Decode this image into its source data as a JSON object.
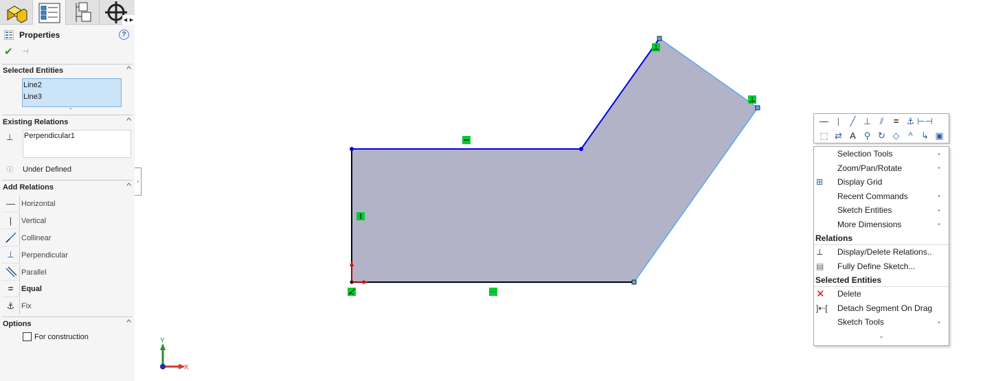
{
  "property_manager": {
    "tabs": [
      {
        "name": "feature-manager",
        "icon": "part-icon"
      },
      {
        "name": "property-manager",
        "icon": "property-list-icon",
        "active": true
      },
      {
        "name": "configuration-manager",
        "icon": "configuration-tree-icon"
      },
      {
        "name": "dim-xpert-manager",
        "icon": "crosshair-icon"
      }
    ],
    "title": "Properties",
    "help_icon": "?",
    "selected_entities": {
      "title": "Selected Entities",
      "items": [
        "Line2",
        "Line3"
      ]
    },
    "existing_relations": {
      "title": "Existing Relations",
      "items": [
        "Perpendicular1"
      ],
      "status": "Under Defined"
    },
    "add_relations": {
      "title": "Add Relations",
      "items": [
        {
          "label": "Horizontal",
          "icon": "horizontal-icon",
          "glyph": "—",
          "underline": "H",
          "bold": false
        },
        {
          "label": "Vertical",
          "icon": "vertical-icon",
          "glyph": "|",
          "bold": false
        },
        {
          "label": "Collinear",
          "icon": "collinear-icon",
          "glyph": "╱",
          "bold": false
        },
        {
          "label": "Perpendicular",
          "icon": "perpendicular-icon",
          "glyph": "⊥",
          "bold": false
        },
        {
          "label": "Parallel",
          "icon": "parallel-icon",
          "glyph": "⫽",
          "bold": false
        },
        {
          "label": "Equal",
          "icon": "equal-icon",
          "glyph": "=",
          "bold": true
        },
        {
          "label": "Fix",
          "icon": "fix-anchor-icon",
          "glyph": "⚓",
          "bold": false
        }
      ]
    },
    "options": {
      "title": "Options",
      "for_construction_label": "For construction",
      "for_construction_checked": false
    }
  },
  "sketch": {
    "relation_badges": [
      "horizontal",
      "vertical",
      "perpendicular",
      "perpendicular",
      "horizontal",
      "fixed-origin"
    ],
    "fill_color": "#b3b3c8",
    "selected_line_color": "#0000e0",
    "highlight_line_color": "#5aa8ee",
    "badge_color": "#00cc33",
    "triad": {
      "x_label": "X",
      "y_label": "Y"
    }
  },
  "context_toolbar": {
    "row1": [
      "horizontal-icon",
      "vertical-icon",
      "collinear-icon",
      "perpendicular-icon",
      "parallel-icon",
      "equal-icon",
      "fix-icon",
      "smart-dimension-icon"
    ],
    "row2": [
      "select-icon",
      "swap-icon",
      "text-icon",
      "zoom-icon",
      "rotate-icon",
      "tangent-icon",
      "corner-icon",
      "offset-icon",
      "view-icon"
    ]
  },
  "context_menu": {
    "items_top": [
      {
        "label": "Selection Tools",
        "submenu": true
      },
      {
        "label": "Zoom/Pan/Rotate",
        "submenu": true
      },
      {
        "label": "Display Grid",
        "submenu": false,
        "icon": "grid-icon"
      },
      {
        "label": "Recent Commands",
        "submenu": true
      },
      {
        "label": "Sketch Entities",
        "submenu": true
      },
      {
        "label": "More Dimensions",
        "submenu": true
      }
    ],
    "relations_header": "Relations",
    "relations_items": [
      {
        "label": "Display/Delete Relations..",
        "icon": "display-relations-icon"
      },
      {
        "label": "Fully Define Sketch...",
        "icon": "fully-define-icon"
      }
    ],
    "selected_header": "Selected Entities",
    "selected_items": [
      {
        "label": "Delete",
        "icon": "delete-icon"
      },
      {
        "label": "Detach Segment On Drag",
        "icon": "detach-segment-icon"
      },
      {
        "label": "Sketch Tools",
        "submenu": true
      }
    ],
    "more_indicator": "⌄"
  }
}
